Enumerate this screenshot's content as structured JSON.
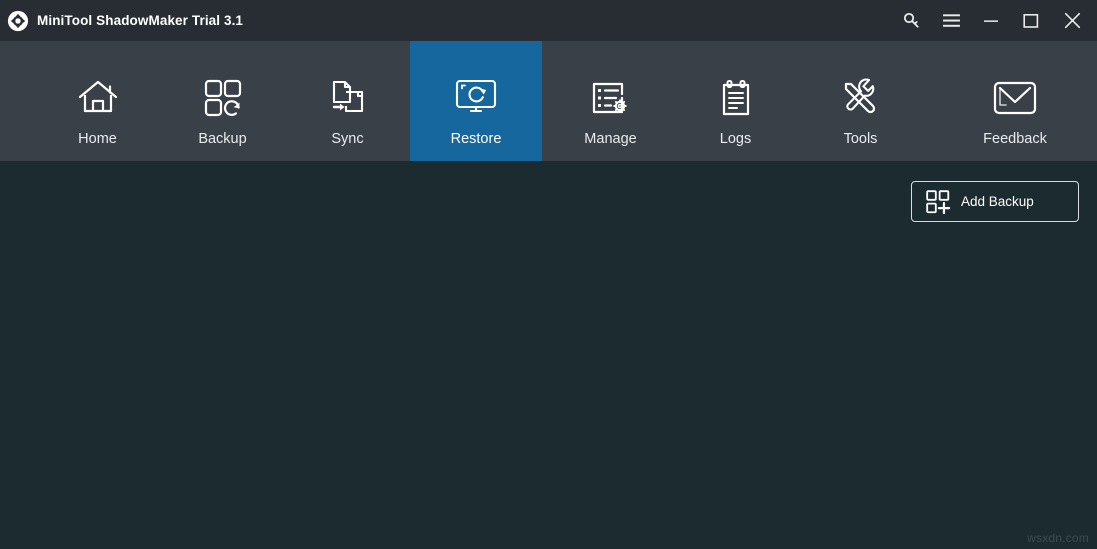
{
  "window": {
    "title": "MiniTool ShadowMaker Trial 3.1",
    "logo_icon": "sync-arrows-logo-icon",
    "controls": [
      {
        "name": "key-icon",
        "label": "Register"
      },
      {
        "name": "hamburger-menu-icon",
        "label": "Menu"
      },
      {
        "name": "minimize-icon",
        "label": "Minimize"
      },
      {
        "name": "maximize-icon",
        "label": "Maximize"
      },
      {
        "name": "close-icon",
        "label": "Close"
      }
    ],
    "titlebar_bg": "#282d33"
  },
  "nav": {
    "bg": "#3a4048",
    "active_bg": "#16679e",
    "active_index": 3,
    "items": [
      {
        "label": "Home",
        "icon": "house-icon"
      },
      {
        "label": "Backup",
        "icon": "backup-squares-refresh-icon"
      },
      {
        "label": "Sync",
        "icon": "sync-documents-arrow-icon"
      },
      {
        "label": "Restore",
        "icon": "restore-monitor-refresh-icon"
      },
      {
        "label": "Manage",
        "icon": "manage-list-gear-icon"
      },
      {
        "label": "Logs",
        "icon": "logs-clipboard-icon"
      },
      {
        "label": "Tools",
        "icon": "tools-wrench-screwdriver-icon"
      },
      {
        "label": "Feedback",
        "icon": "feedback-envelope-icon"
      }
    ]
  },
  "content": {
    "bg": "#1c2b2f",
    "add_backup": {
      "label": "Add Backup",
      "icon": "add-backup-squares-plus-icon"
    },
    "watermark": "wsxdn.com"
  }
}
